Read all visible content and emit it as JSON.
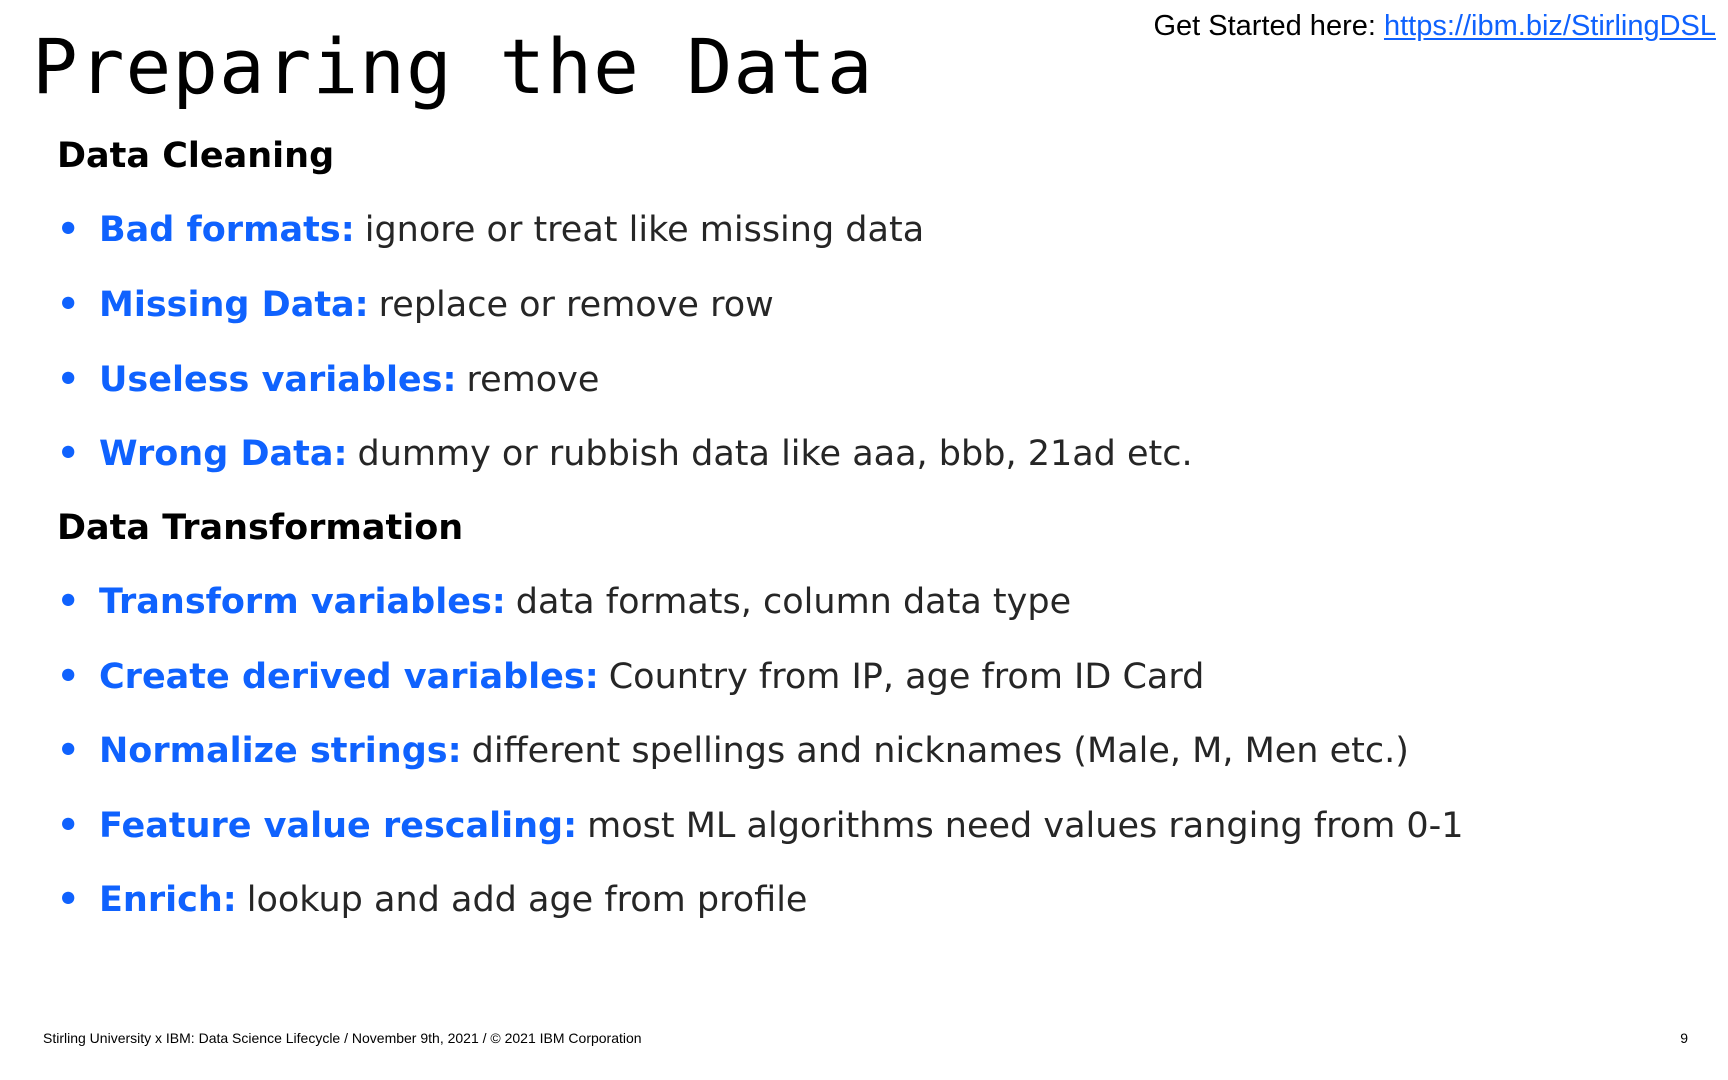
{
  "header": {
    "title": "Preparing the Data",
    "get_started_label": "Get Started here:",
    "get_started_link": "https://ibm.biz/StirlingDSL"
  },
  "sections": [
    {
      "heading": "Data Cleaning",
      "items": [
        {
          "term": "Bad formats:",
          "desc": "ignore or treat like missing data"
        },
        {
          "term": "Missing Data:",
          "desc": "replace or remove row"
        },
        {
          "term": "Useless variables:",
          "desc": "remove"
        },
        {
          "term": "Wrong Data:",
          "desc": "dummy or rubbish data like aaa, bbb, 21ad etc."
        }
      ]
    },
    {
      "heading": "Data Transformation",
      "items": [
        {
          "term": "Transform variables:",
          "desc": "data formats, column data type"
        },
        {
          "term": "Create derived variables:",
          "desc": "Country from IP, age from ID Card"
        },
        {
          "term": "Normalize strings:",
          "desc": "different spellings and nicknames (Male, M, Men etc.)"
        },
        {
          "term": "Feature value rescaling:",
          "desc": "most ML algorithms need values ranging from 0-1"
        },
        {
          "term": "Enrich:",
          "desc": "lookup and add age from profile"
        }
      ]
    }
  ],
  "bullet_glyph": "•",
  "footer": {
    "text": "Stirling University x IBM: Data Science Lifecycle / November 9th, 2021 / © 2021 IBM Corporation",
    "page_number": "9"
  },
  "colors": {
    "accent": "#0f62fe",
    "text": "#161616",
    "background": "#ffffff"
  }
}
